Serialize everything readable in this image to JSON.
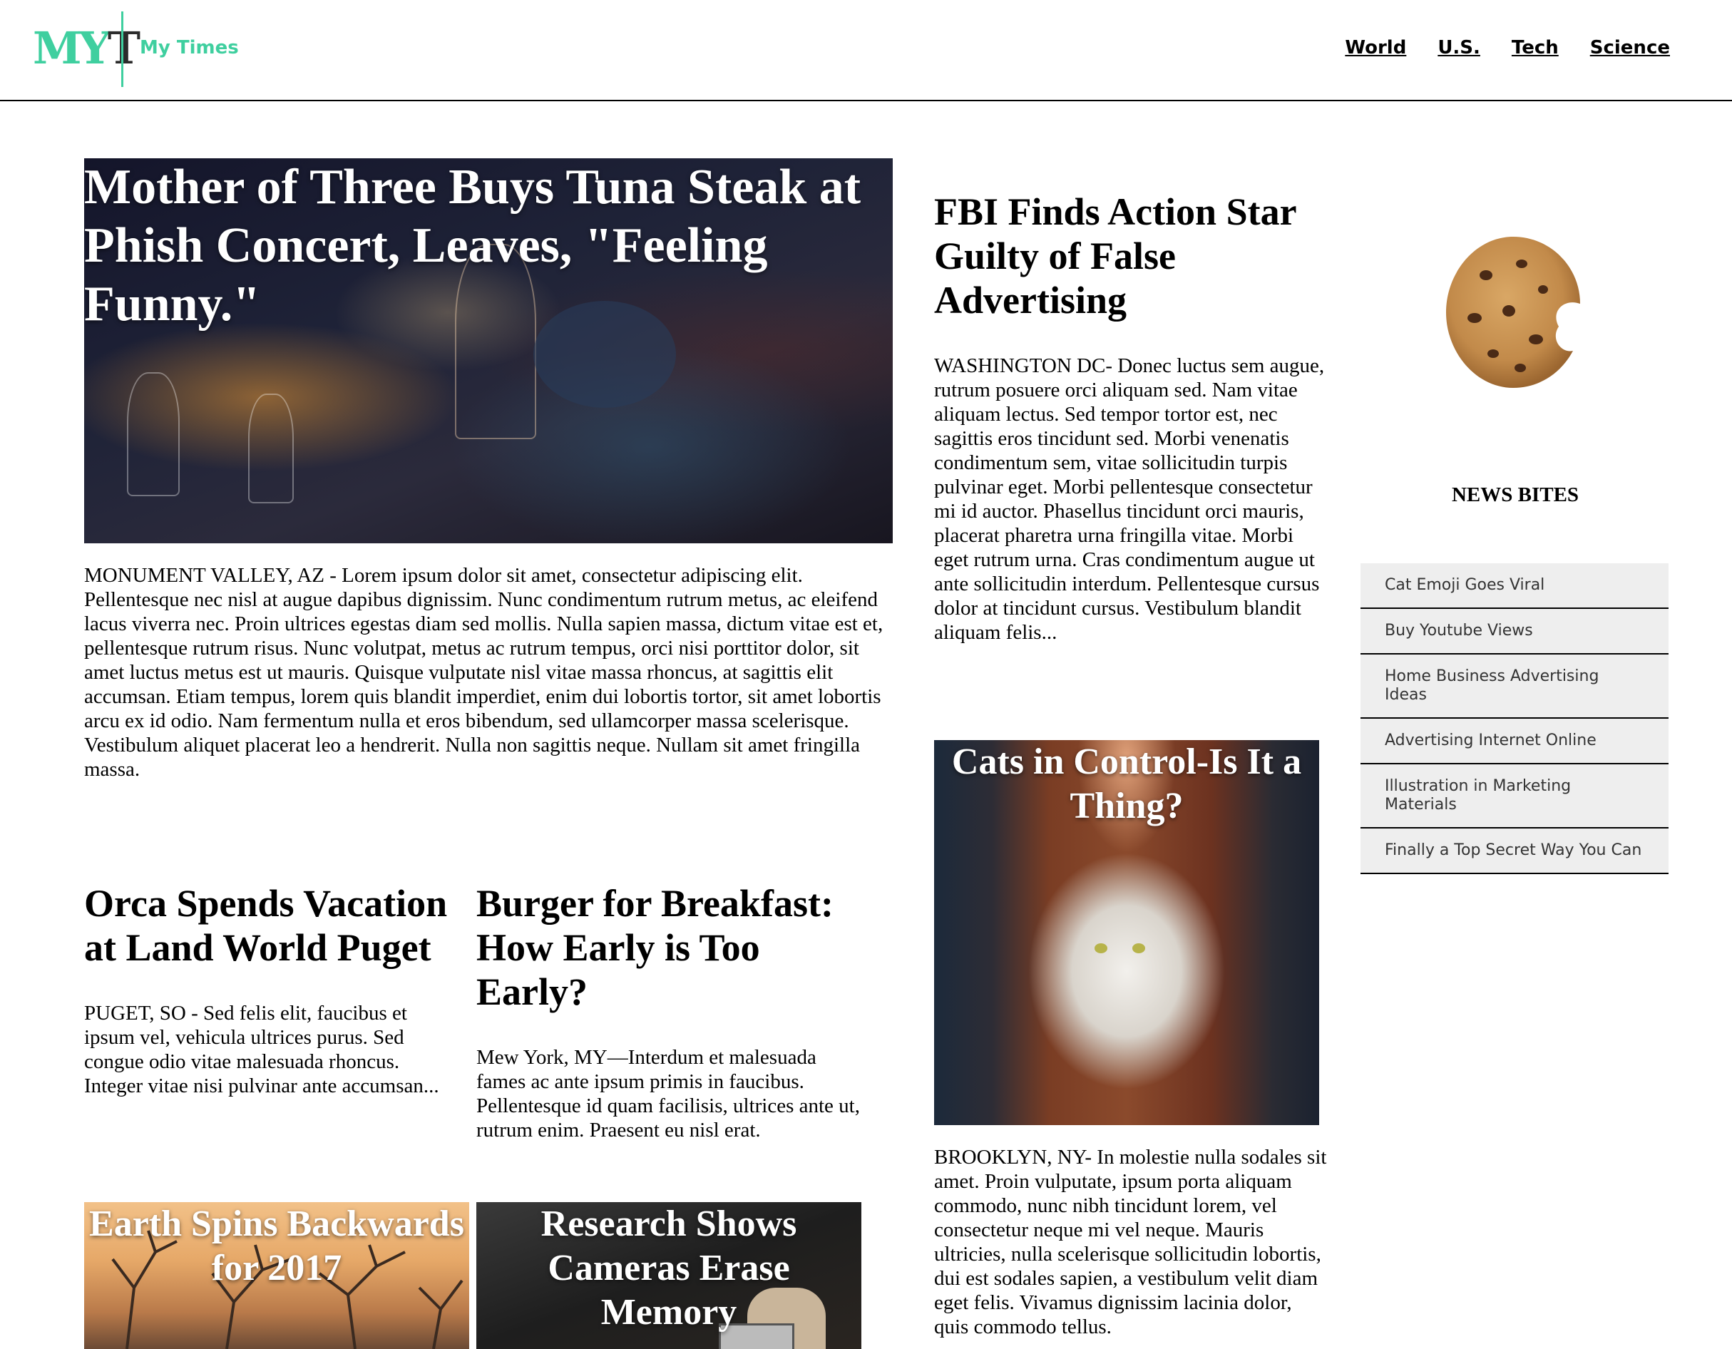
{
  "header": {
    "logo_m": "MY",
    "logo_t": "T",
    "site_name": "My Times",
    "nav": [
      "World",
      "U.S.",
      "Tech",
      "Science"
    ]
  },
  "feature": {
    "title": "Mother of Three Buys Tuna Steak at Phish Concert, Leaves, \"Feeling Funny.\"",
    "body": "MONUMENT VALLEY, AZ - Lorem ipsum dolor sit amet, consectetur adipiscing elit. Pellentesque nec nisl at augue dapibus dignissim. Nunc condimentum rutrum metus, ac eleifend lacus viverra nec. Proin ultrices egestas diam sed mollis. Nulla sapien massa, dictum vitae est et, pellentesque rutrum risus. Nunc volutpat, metus ac rutrum tempus, orci nisi porttitor dolor, sit amet luctus metus est ut mauris. Quisque vulputate nisl vitae massa rhoncus, at sagittis elit accumsan. Etiam tempus, lorem quis blandit imperdiet, enim dui lobortis tortor, sit amet lobortis arcu ex id odio. Nam fermentum nulla et eros bibendum, sed ullamcorper massa scelerisque. Vestibulum aliquet placerat leo a hendrerit. Nulla non sagittis neque. Nullam sit amet fringilla massa."
  },
  "orca": {
    "title": "Orca Spends Vacation at Land World Puget",
    "body": "PUGET, SO - Sed felis elit, faucibus et ipsum vel, vehicula ultrices purus. Sed congue odio vitae malesuada rhoncus. Integer vitae nisi pulvinar ante accumsan..."
  },
  "burger": {
    "title": "Burger for Breakfast: How Early is Too Early?",
    "body": "Mew York, MY—Interdum et malesuada fames ac ante ipsum primis in faucibus. Pellentesque id quam facilisis, ultrices ante ut, rutrum enim. Praesent eu nisl erat."
  },
  "earth": {
    "title": "Earth Spins Backwards for 2017"
  },
  "research": {
    "title": "Research Shows Cameras Erase Memory"
  },
  "fbi": {
    "title": "FBI Finds Action Star Guilty of False Advertising",
    "body": "WASHINGTON DC- Donec luctus sem augue, rutrum posuere orci aliquam sed. Nam vitae aliquam lectus. Sed tempor tortor est, nec sagittis eros tincidunt sed. Morbi venenatis condimentum sem, vitae sollicitudin turpis pulvinar eget. Morbi pellentesque consectetur mi id auctor. Phasellus tincidunt orci mauris, placerat pharetra urna fringilla vitae. Morbi eget rutrum urna. Cras condimentum augue ut ante sollicitudin interdum. Pellentesque cursus dolor at tincidunt cursus. Vestibulum blandit aliquam felis..."
  },
  "cats": {
    "title": "Cats in Control-Is It a Thing?",
    "body": "BROOKLYN, NY- In molestie nulla sodales sit amet. Proin vulputate, ipsum porta aliquam commodo, nunc nibh tincidunt lorem, vel consectetur neque mi vel neque. Mauris ultricies, nulla scelerisque sollicitudin lobortis, dui est sodales sapien, a vestibulum velit diam eget felis. Vivamus dignissim lacinia dolor, quis commodo tellus."
  },
  "sidebar": {
    "title": "NEWS BITES",
    "items": [
      "Cat Emoji Goes Viral",
      "Buy Youtube Views",
      "Home Business Advertising Ideas",
      "Advertising Internet Online",
      "Illustration in Marketing Materials",
      "Finally a Top Secret Way You Can"
    ]
  },
  "colors": {
    "accent": "#3fcf9f",
    "list_bg": "#eeeeee"
  }
}
